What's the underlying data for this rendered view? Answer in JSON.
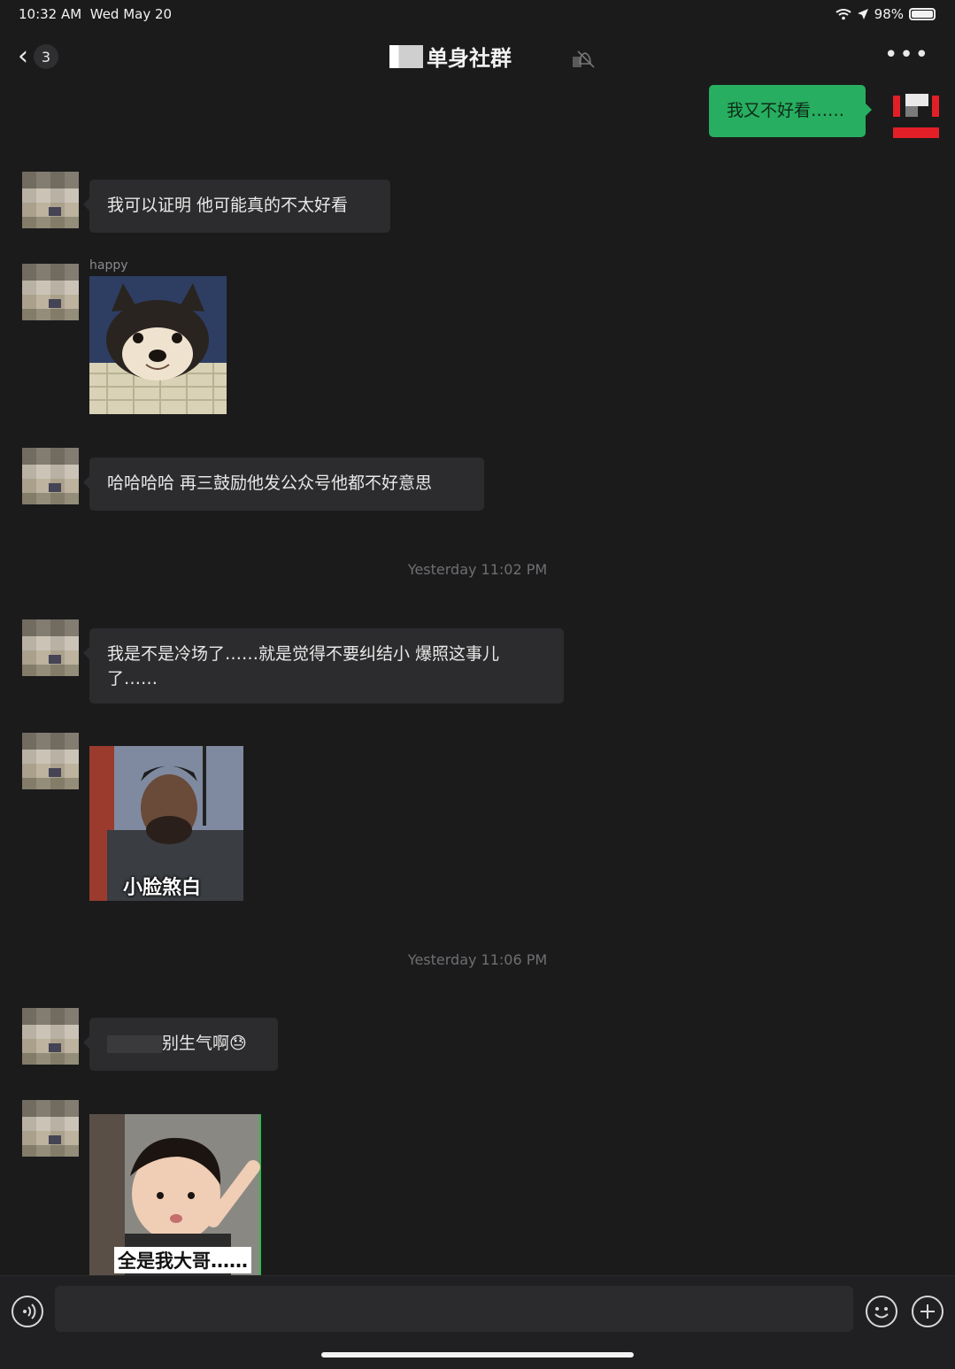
{
  "status_bar": {
    "time": "10:32 AM",
    "date": "Wed May 20",
    "battery": "98%"
  },
  "nav": {
    "unread_count": "3",
    "title": "单身社群"
  },
  "messages": {
    "m1": "我又不好看……",
    "m2": "我可以证明 他可能真的不太好看",
    "m3_nick": "happy",
    "m4": "哈哈哈哈 再三鼓励他发公众号他都不好意思",
    "ts1": "Yesterday 11:02 PM",
    "m5": "我是不是冷场了……就是觉得不要纠结小 爆照这事儿了……",
    "m6_caption": "小脸煞白",
    "ts2": "Yesterday 11:06 PM",
    "m7": "别生气啊😓",
    "m8_caption": "全是我大哥……"
  },
  "input": {
    "placeholder": ""
  },
  "icons": {
    "back": "chevron-left-icon",
    "mute": "bell-slash-icon",
    "more": "more-dots-icon",
    "voice": "voice-icon",
    "emoji": "emoji-icon",
    "plus": "plus-icon"
  },
  "colors": {
    "self_bubble": "#27ae60",
    "other_bubble": "#2c2c2e",
    "background": "#1b1b1c"
  }
}
